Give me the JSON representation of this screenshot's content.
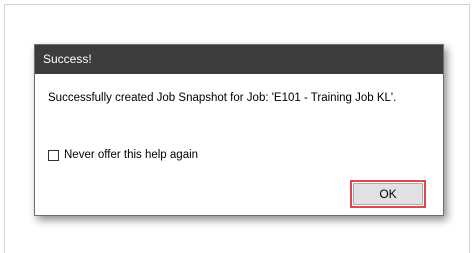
{
  "dialog": {
    "title": "Success!",
    "message": "Successfully created Job Snapshot for Job: 'E101 - Training Job KL'.",
    "checkbox_label": "Never offer this help again",
    "checkbox_checked": false,
    "ok_label": "OK",
    "highlight_color": "#e0474c"
  }
}
